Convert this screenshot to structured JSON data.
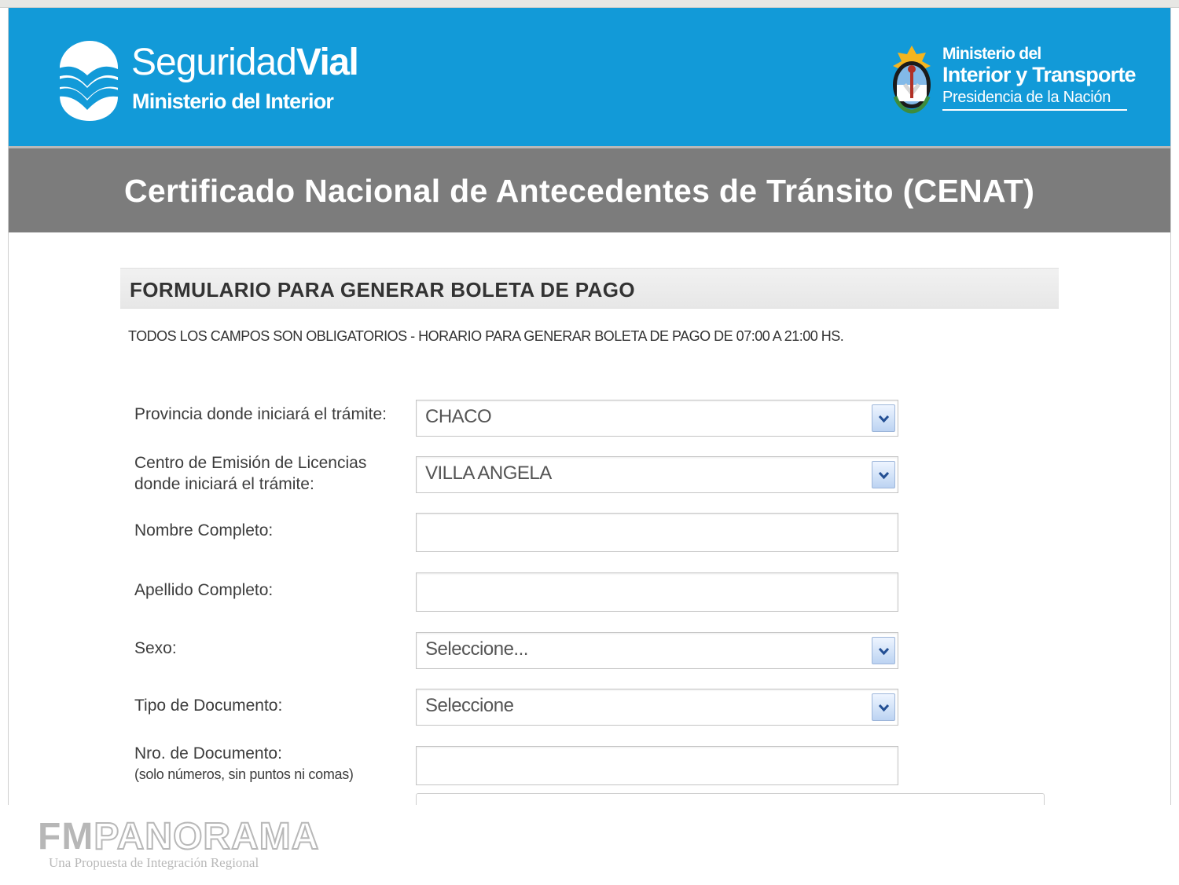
{
  "header": {
    "brand_name_regular": "Seguridad",
    "brand_name_bold": "Vial",
    "brand_subtitle": "Ministerio del Interior",
    "ministry_line1": "Ministerio del",
    "ministry_line2": "Interior y Transporte",
    "ministry_line3": "Presidencia de la Nación",
    "banner_color": "#129ad8"
  },
  "title_bar": {
    "title": "Certificado Nacional de Antecedentes de Tránsito (CENAT)",
    "background_color": "#7c7c7c"
  },
  "form": {
    "section_title": "FORMULARIO PARA GENERAR BOLETA DE PAGO",
    "notice": "TODOS LOS CAMPOS SON OBLIGATORIOS - HORARIO PARA GENERAR BOLETA DE PAGO DE 07:00 A 21:00 HS.",
    "fields": {
      "provincia": {
        "label": "Provincia donde iniciará el trámite:",
        "value": "CHACO",
        "icon": "chevron-down-icon"
      },
      "centro": {
        "label_line1": "Centro de Emisión de Licencias",
        "label_line2": "donde iniciará el trámite:",
        "value": "VILLA ANGELA",
        "icon": "chevron-down-icon"
      },
      "nombre": {
        "label": "Nombre Completo:",
        "value": ""
      },
      "apellido": {
        "label": "Apellido Completo:",
        "value": ""
      },
      "sexo": {
        "label": "Sexo:",
        "value": "Seleccione...",
        "icon": "chevron-down-icon"
      },
      "tipo_documento": {
        "label": "Tipo de Documento:",
        "value": "Seleccione",
        "icon": "chevron-down-icon"
      },
      "numero_documento": {
        "label": "Nro. de Documento:",
        "note": "(solo números, sin puntos ni comas)",
        "value": ""
      }
    }
  },
  "watermark": {
    "fm": "FM",
    "panorama": "PANORAMA",
    "subtitle": "Una Propuesta de Integración Regional"
  }
}
